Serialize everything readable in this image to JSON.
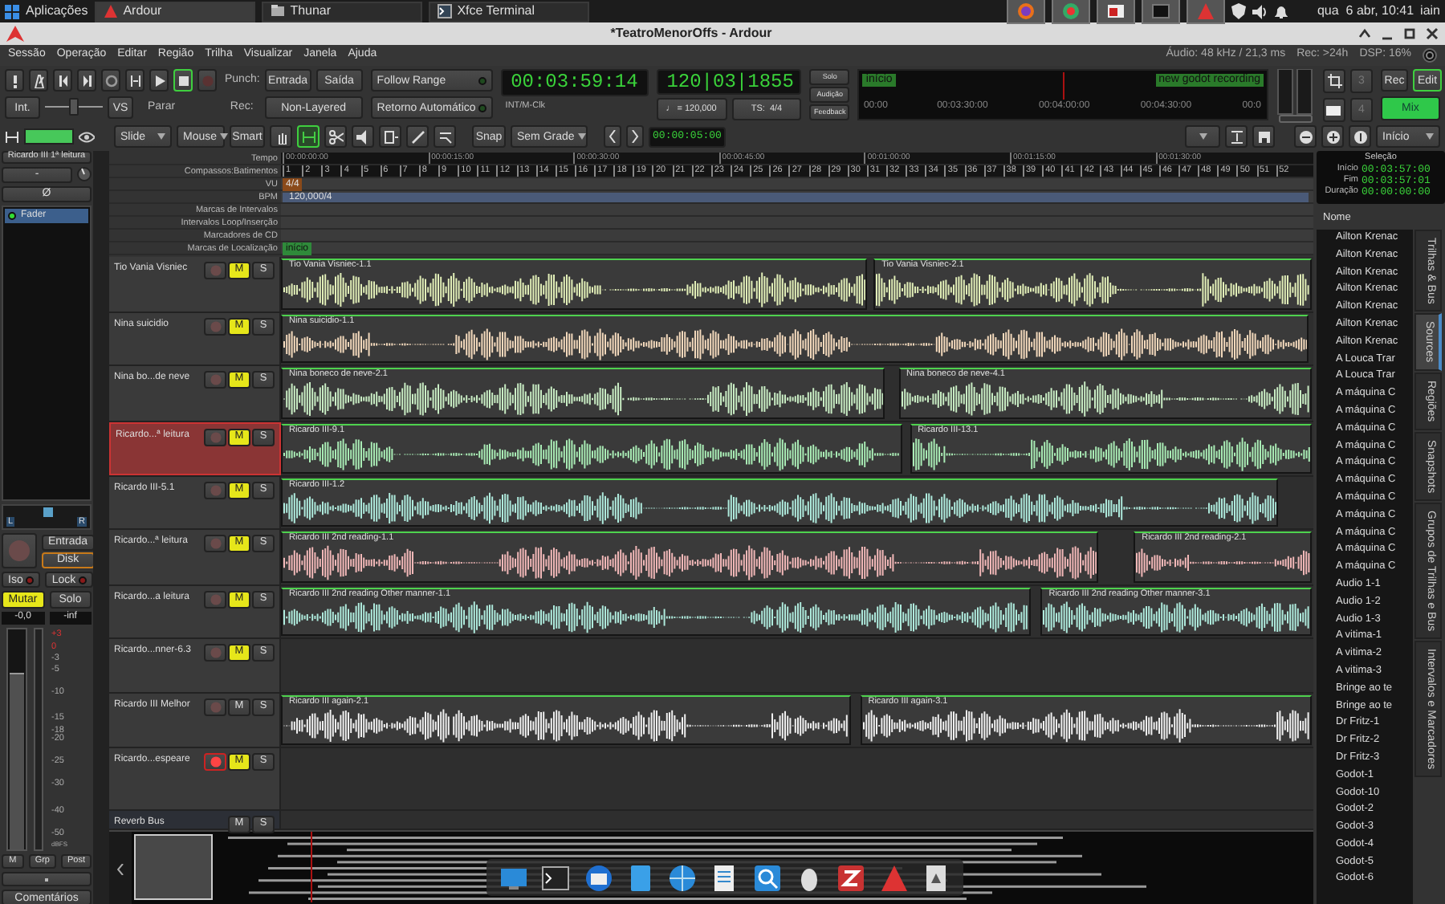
{
  "top_panel": {
    "apps_menu": "Aplicações",
    "tasks": [
      {
        "label": "Ardour",
        "selected": true
      },
      {
        "label": "Thunar",
        "selected": false
      },
      {
        "label": "Xfce Terminal",
        "selected": false
      }
    ],
    "clock": "qua  6 abr, 10:41",
    "user": "iain"
  },
  "window": {
    "title": "*TeatroMenorOffs - Ardour"
  },
  "menu": [
    "Sessão",
    "Operação",
    "Editar",
    "Região",
    "Trilha",
    "Visualizar",
    "Janela",
    "Ajuda"
  ],
  "status": [
    "Áudio: 48 kHz / 21,3 ms",
    "Rec: >24h",
    "DSP: 16%"
  ],
  "transport": {
    "buttons": [
      {
        "kind": "panic",
        "on": false
      },
      {
        "kind": "metronome",
        "on": false
      },
      {
        "kind": "start",
        "on": false
      },
      {
        "kind": "end",
        "on": false
      },
      {
        "kind": "loop",
        "on": false
      },
      {
        "kind": "range",
        "on": false
      },
      {
        "kind": "play",
        "on": false
      },
      {
        "kind": "stop",
        "on": true
      },
      {
        "kind": "record",
        "on": false
      }
    ],
    "shuttle": {
      "level": 0.5
    },
    "int": "Int.",
    "vs": "VS",
    "stop_label": "Parar",
    "punch_label": "Punch:",
    "punch_in": "Entrada",
    "punch_out": "Saída",
    "rec_label": "Rec:",
    "rec_mode": "Non-Layered",
    "follow_range": "Follow Range",
    "auto_return": "Retorno Automático",
    "primary_clock": "00:03:59:14",
    "clock_source": "INT/M-Clk",
    "bbt_clock": "120|03|1855",
    "tempo": "♩ = 120,000",
    "meter": "TS:  4/4",
    "monitor": [
      "Solo",
      "Audição",
      "Feedback"
    ],
    "mini_timeline": {
      "start_marker": "início",
      "end_marker": "new godot recording",
      "times": [
        "00:00",
        "00:03:30:00",
        "00:04:00:00",
        "00:04:30:00",
        "00:0"
      ]
    },
    "snapshot_buttons": [
      "3",
      "4"
    ],
    "rec_button": "Rec",
    "edit_button": {
      "label": "Edit",
      "selected": false
    },
    "mix_button": {
      "label": "Mix",
      "selected": true
    }
  },
  "edit_toolbar": {
    "edit_mode": "Slide",
    "ripple": "Mouse",
    "grab": "Smart",
    "tools": [
      {
        "kind": "grab",
        "selected": false
      },
      {
        "kind": "range",
        "selected": true
      },
      {
        "kind": "cut",
        "selected": false
      },
      {
        "kind": "audition",
        "selected": false
      },
      {
        "kind": "stretch",
        "selected": false
      },
      {
        "kind": "draw",
        "selected": false
      },
      {
        "kind": "internal",
        "selected": false
      }
    ],
    "snap": "Snap",
    "grid": "Sem Grade",
    "nudge_clock": "00:00:05:00",
    "zoom_focus": "Início"
  },
  "rulers": {
    "labels": [
      "Tempo",
      "Compassos:Batimentos",
      "VU",
      "BPM",
      "Marcas de Intervalos",
      "Intervalos Loop/Inserção",
      "Marcadores de CD",
      "Marcas de Localização"
    ],
    "timecode": [
      "00:00:00:00",
      "00:00:15:00",
      "00:00:30:00",
      "00:00:45:00",
      "00:01:00:00",
      "00:01:15:00",
      "00:01:30:00"
    ],
    "bars": [
      "1",
      "2",
      "3",
      "4",
      "5",
      "6",
      "7",
      "8",
      "9",
      "10",
      "11",
      "12",
      "13",
      "14",
      "15",
      "16",
      "17",
      "18",
      "19",
      "20",
      "21",
      "22",
      "23",
      "24",
      "25",
      "26",
      "27",
      "28",
      "29",
      "30",
      "31",
      "32",
      "33",
      "34",
      "35",
      "36",
      "37",
      "38",
      "39",
      "40",
      "41",
      "42",
      "43",
      "44",
      "45",
      "46",
      "47",
      "48",
      "49",
      "50",
      "51",
      "52"
    ],
    "meter_marker": "4/4",
    "tempo_marker": "120,000/4",
    "location_marker": "início"
  },
  "tracks": [
    {
      "kind": "audio",
      "name": "Tio Vania Visniec",
      "rec_armed": false,
      "muted": true,
      "soloed": false,
      "selected": false,
      "mute_label": "M",
      "solo_label": "S",
      "color": "#e2efb8",
      "regions": [
        "Tio Vania Visniec-1.1",
        "Tio Vania Visniec-2.1"
      ]
    },
    {
      "kind": "audio",
      "name": "Nina suicidio",
      "rec_armed": false,
      "muted": true,
      "soloed": false,
      "selected": false,
      "mute_label": "M",
      "solo_label": "S",
      "color": "#f3d9bc",
      "regions": [
        "Nina suicidio-1.1"
      ]
    },
    {
      "kind": "audio",
      "name": "Nina bo...de neve",
      "rec_armed": false,
      "muted": true,
      "soloed": false,
      "selected": false,
      "mute_label": "M",
      "solo_label": "S",
      "color": "#c9edc4",
      "regions": [
        "Nina boneco de neve-2.1",
        "Nina boneco de neve-4.1"
      ]
    },
    {
      "kind": "audio",
      "name": "Ricardo...ª leitura",
      "rec_armed": false,
      "muted": true,
      "soloed": false,
      "selected": true,
      "mute_label": "M",
      "solo_label": "S",
      "color": "#a9ecb5",
      "regions": [
        "Ricardo III-9.1",
        "Ricardo III-13.1"
      ]
    },
    {
      "kind": "audio",
      "name": "Ricardo III-5.1",
      "rec_armed": false,
      "muted": true,
      "soloed": false,
      "selected": false,
      "mute_label": "M",
      "solo_label": "S",
      "color": "#aeeadc",
      "regions": [
        "Ricardo III-1.2"
      ]
    },
    {
      "kind": "audio",
      "name": "Ricardo...ª leitura",
      "rec_armed": false,
      "muted": true,
      "soloed": false,
      "selected": false,
      "mute_label": "M",
      "solo_label": "S",
      "color": "#f2b8b8",
      "regions": [
        "Ricardo III 2nd reading-1.1",
        "Ricardo III 2nd reading-2.1"
      ]
    },
    {
      "kind": "audio",
      "name": "Ricardo...a leitura",
      "rec_armed": false,
      "muted": true,
      "soloed": false,
      "selected": false,
      "mute_label": "M",
      "solo_label": "S",
      "color": "#aeeadc",
      "regions": [
        "Ricardo III 2nd reading Other manner-1.1",
        "Ricardo III 2nd reading Other manner-3.1"
      ]
    },
    {
      "kind": "audio",
      "name": "Ricardo...nner-6.3",
      "rec_armed": false,
      "muted": true,
      "soloed": false,
      "selected": false,
      "mute_label": "M",
      "solo_label": "S"
    },
    {
      "kind": "audio",
      "name": "Ricardo III Melhor",
      "rec_armed": false,
      "muted": false,
      "soloed": false,
      "selected": false,
      "mute_label": "M",
      "solo_label": "S",
      "color": "#f0f0f0",
      "regions": [
        "Ricardo III again-2.1",
        "Ricardo III again-3.1"
      ]
    },
    {
      "kind": "audio",
      "name": "Ricardo...espeare",
      "rec_armed": true,
      "muted": true,
      "soloed": false,
      "selected": false,
      "mute_label": "M",
      "solo_label": "S"
    },
    {
      "kind": "bus",
      "name": "Reverb Bus",
      "muted": false,
      "soloed": false,
      "selected": false,
      "mute_label": "M",
      "solo_label": "S"
    }
  ],
  "mixer_strip": {
    "name": "Ricardo III 1ª leitura",
    "input": "-",
    "phase": "Ø",
    "plugins": [
      {
        "name": "Fader",
        "selected": true
      }
    ],
    "pan_left": "L",
    "pan_right": "R",
    "input_button": "Entrada",
    "disk_button": "Disk",
    "iso": "Iso",
    "lock": "Lock",
    "mute": {
      "label": "Mutar",
      "on": true
    },
    "solo": {
      "label": "Solo",
      "on": false
    },
    "gain": "-0,0",
    "peak": "-inf",
    "fader": {
      "level": 0.8
    },
    "meter_scale": [
      "+3",
      "0",
      "-3",
      "-5",
      "-10",
      "-15",
      "-18",
      "-20",
      "-25",
      "-30",
      "-40",
      "-50",
      "dBFS"
    ],
    "bottom_buttons": [
      "M",
      "Grp",
      "Post"
    ],
    "comments": "Comentários"
  },
  "selection_clock": {
    "title": "Seleção",
    "rows": [
      {
        "label": "Início",
        "value": "00:03:57:00"
      },
      {
        "label": "Fim",
        "value": "00:03:57:01"
      },
      {
        "label": "Duração",
        "value": "00:00:00:00"
      }
    ]
  },
  "sidebar": {
    "column": "Nome",
    "items": [
      "Ailton Krenac",
      "Ailton Krenac",
      "Ailton Krenac",
      "Ailton Krenac",
      "Ailton Krenac",
      "Ailton Krenac",
      "Ailton Krenac",
      "A Louca Trar",
      "A Louca Trar",
      "A máquina C",
      "A máquina C",
      "A máquina C",
      "A máquina C",
      "A máquina C",
      "A máquina C",
      "A máquina C",
      "A máquina C",
      "A máquina C",
      "A máquina C",
      "A máquina C",
      "Audio 1-1",
      "Audio 1-2",
      "Audio 1-3",
      "A vitima-1",
      "A vitima-2",
      "A vitima-3",
      "Bringe ao te",
      "Bringe ao te",
      "Dr Fritz-1",
      "Dr Fritz-2",
      "Dr Fritz-3",
      "Godot-1",
      "Godot-10",
      "Godot-2",
      "Godot-3",
      "Godot-4",
      "Godot-5",
      "Godot-6"
    ],
    "tabs": [
      {
        "label": "Trilhas & Bus",
        "selected": false
      },
      {
        "label": "Sources",
        "selected": true
      },
      {
        "label": "Regiões",
        "selected": false
      },
      {
        "label": "Snapshots",
        "selected": false
      },
      {
        "label": "Grupos de Trilhas e Bus",
        "selected": false
      },
      {
        "label": "Intervalos e Marcadores",
        "selected": false
      }
    ]
  }
}
